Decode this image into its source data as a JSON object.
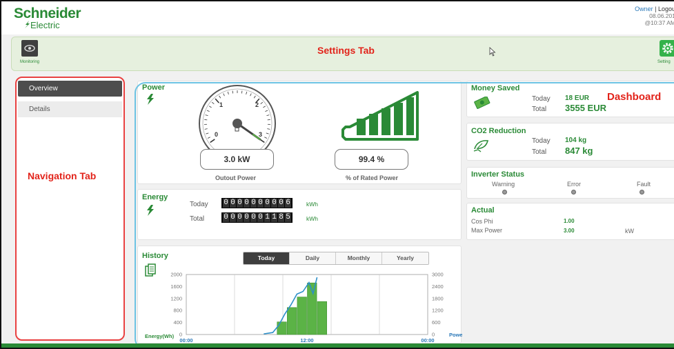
{
  "header": {
    "brand_line1": "Schneider",
    "brand_line2": "Electric",
    "user": "Owner",
    "separator": "|",
    "logout": "Logou",
    "date": "08.06.201",
    "time": "@10:37 AM"
  },
  "toolbar": {
    "monitoring_label": "Monitoring",
    "settings_label": "Setting",
    "monitoring_icon": "eye-icon",
    "settings_icon": "gear-icon"
  },
  "annotations": {
    "settings_tab": "Settings Tab",
    "navigation_tab": "Navigation Tab",
    "dashboard": "Dashboard"
  },
  "nav": {
    "items": [
      {
        "label": "Overview",
        "active": true
      },
      {
        "label": "Details",
        "active": false
      }
    ]
  },
  "power": {
    "title": "Power",
    "output_value": "3.0 kW",
    "output_label": "Outout Power",
    "rated_value": "99.4 %",
    "rated_label": "% of Rated Power",
    "gauge_ticks": [
      "0",
      "1",
      "2",
      "3"
    ],
    "gauge_reading_kw": 3.0,
    "gauge_max_kw": 3
  },
  "energy": {
    "title": "Energy",
    "today_label": "Today",
    "today_digits": "0000000006",
    "total_label": "Total",
    "total_digits": "0000001185",
    "unit": "kWh"
  },
  "money": {
    "title": "Money Saved",
    "today_label": "Today",
    "today_value": "18 EUR",
    "total_label": "Total",
    "total_value": "3555 EUR"
  },
  "co2": {
    "title": "CO2 Reduction",
    "today_label": "Today",
    "today_value": "104 kg",
    "total_label": "Total",
    "total_value": "847 kg"
  },
  "inverter": {
    "title": "Inverter Status",
    "warning": "Warning",
    "error": "Error",
    "fault": "Fault"
  },
  "actual": {
    "title": "Actual",
    "cos_phi_label": "Cos Phi",
    "cos_phi_value": "1.00",
    "max_power_label": "Max Power",
    "max_power_value": "3.00",
    "max_power_unit": "kW"
  },
  "history": {
    "title": "History",
    "tabs": [
      "Today",
      "Daily",
      "Monthly",
      "Yearly"
    ],
    "active_tab": "Today",
    "left_axis_label": "Energy(Wh)",
    "right_axis_label": "Power (W)",
    "x_ticks": [
      "00:00",
      "12:00",
      "00:00"
    ]
  },
  "colors": {
    "brand_green": "#2a8a36",
    "bar_green": "#5bb346",
    "line_blue": "#2c8fc9",
    "annotation_red": "#e2231a"
  },
  "chart_data": {
    "type": "bar",
    "xlabel": "",
    "ylabel": "Energy(Wh)",
    "y2label": "Power (W)",
    "ylim": [
      0,
      2000
    ],
    "y2lim": [
      0,
      3000
    ],
    "yticks": [
      "0",
      "400",
      "800",
      "1200",
      "1600",
      "2000"
    ],
    "y2ticks": [
      "0",
      "600",
      "1200",
      "1800",
      "2400",
      "3000"
    ],
    "bar_hours": [
      9,
      10,
      11,
      12,
      13
    ],
    "bar_values": [
      420,
      900,
      1250,
      1720,
      1100
    ],
    "power_line": {
      "hours": [
        7.7,
        8.6,
        9.2,
        9.8,
        10.4,
        11.0,
        11.6,
        12.2,
        12.6,
        13.0
      ],
      "values": [
        30,
        100,
        470,
        1030,
        1480,
        2020,
        2150,
        2600,
        2050,
        2860
      ]
    }
  }
}
